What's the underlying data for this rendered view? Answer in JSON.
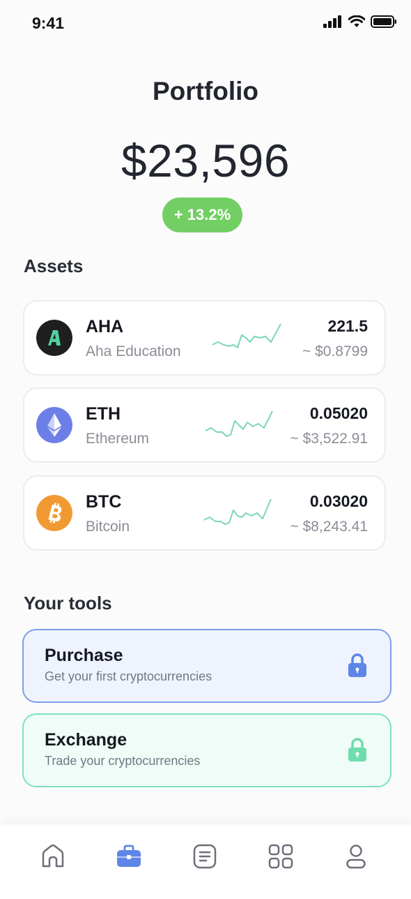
{
  "status_bar": {
    "time": "9:41"
  },
  "header": {
    "title": "Portfolio"
  },
  "portfolio": {
    "balance": "$23,596",
    "change": "+ 13.2%"
  },
  "assets_section": {
    "title": "Assets"
  },
  "assets": [
    {
      "symbol": "AHA",
      "name": "Aha Education",
      "amount": "221.5",
      "value": "~ $0.8799",
      "icon": "aha-icon",
      "color": "#1f1f1f"
    },
    {
      "symbol": "ETH",
      "name": "Ethereum",
      "amount": "0.05020",
      "value": "~ $3,522.91",
      "icon": "ethereum-icon",
      "color": "#6c7ee8"
    },
    {
      "symbol": "BTC",
      "name": "Bitcoin",
      "amount": "0.03020",
      "value": "~ $8,243.41",
      "icon": "bitcoin-icon",
      "color": "#f19a34"
    }
  ],
  "tools_section": {
    "title": "Your tools"
  },
  "tools": [
    {
      "title": "Purchase",
      "description": "Get your first cryptocurrencies",
      "icon": "lock-icon",
      "color": "#5d86e8"
    },
    {
      "title": "Exchange",
      "description": "Trade your cryptocurrencies",
      "icon": "lock-icon",
      "color": "#6fdcae"
    }
  ],
  "bottom_nav": [
    {
      "name": "home",
      "icon": "home-icon",
      "active": false
    },
    {
      "name": "portfolio",
      "icon": "briefcase-icon",
      "active": true
    },
    {
      "name": "news",
      "icon": "document-icon",
      "active": false
    },
    {
      "name": "apps",
      "icon": "grid-icon",
      "active": false
    },
    {
      "name": "profile",
      "icon": "user-icon",
      "active": false
    }
  ],
  "colors": {
    "accent": "#5d86e8",
    "positive": "#72cf63",
    "sparkline": "#7ed6b6"
  }
}
